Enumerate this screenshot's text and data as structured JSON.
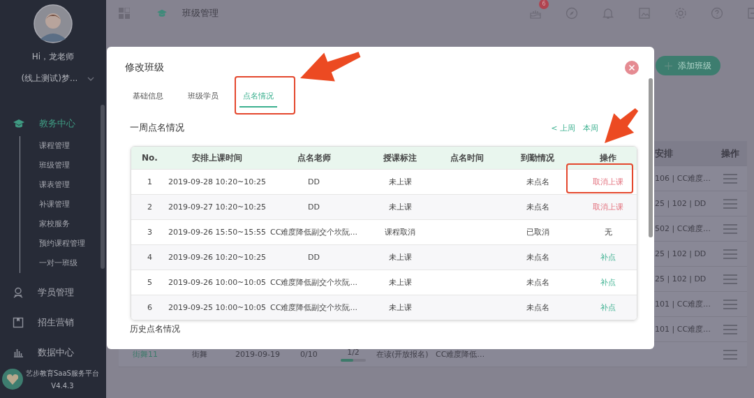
{
  "sidebar": {
    "greeting": "Hi，龙老师",
    "school": "(线上测试)梦...",
    "menu": [
      {
        "label": "教务中心",
        "selected": true,
        "children": [
          {
            "label": "课程管理"
          },
          {
            "label": "班级管理"
          },
          {
            "label": "课表管理"
          },
          {
            "label": "补课管理"
          },
          {
            "label": "家校服务"
          },
          {
            "label": "预约课程管理"
          },
          {
            "label": "一对一班级"
          }
        ]
      },
      {
        "label": "学员管理",
        "selected": false
      },
      {
        "label": "招生营销",
        "selected": false
      },
      {
        "label": "数据中心",
        "selected": false
      }
    ],
    "brand": "艺步教育SaaS服务平台",
    "version": "V4.4.3"
  },
  "topbar": {
    "title": "班级管理",
    "badge": "6"
  },
  "background": {
    "add_button": "添加班级",
    "table": {
      "columns": [
        "安排",
        "操作"
      ],
      "rows": [
        {
          "schedule": "106 | CC难度…"
        },
        {
          "schedule": "25 | 102 | DD"
        },
        {
          "schedule": "502 | CC难度…"
        },
        {
          "schedule": "25 | 102 | DD"
        },
        {
          "schedule": "25 | 102 | DD"
        },
        {
          "schedule": "101 | CC难度…"
        },
        {
          "schedule": "101 | CC难度…"
        },
        {
          "cells": [
            "街舞11",
            "街舞",
            "2019-09-19",
            "0/10"
          ],
          "progress": "1/2",
          "level": 0.5,
          "status": "在读(开放报名)",
          "teacher": "CC难度降低…"
        }
      ]
    }
  },
  "dialog": {
    "title": "修改班级",
    "tabs": [
      {
        "label": "基础信息",
        "selected": false
      },
      {
        "label": "班级学员",
        "selected": false
      },
      {
        "label": "点名情况",
        "selected": true
      }
    ],
    "section": "一周点名情况",
    "week_links": [
      "< 上周",
      "本周"
    ],
    "table": {
      "columns": [
        "No.",
        "安排上课时间",
        "点名老师",
        "授课标注",
        "点名时间",
        "到勤情况",
        "操作"
      ],
      "rows": [
        {
          "no": "1",
          "time": "2019-09-28 10:20~10:25",
          "teacher": "DD",
          "mark": "未上课",
          "attendance": "未点名",
          "action": "取消上课",
          "kind": "cancel"
        },
        {
          "no": "2",
          "time": "2019-09-27 10:20~10:25",
          "teacher": "DD",
          "mark": "未上课",
          "attendance": "未点名",
          "action": "取消上课",
          "kind": "cancel"
        },
        {
          "no": "3",
          "time": "2019-09-26 15:50~15:55",
          "teacher": "CC难度降低副交个坎阮...",
          "mark": "课程取消",
          "attendance": "已取消",
          "action": "无",
          "kind": "none"
        },
        {
          "no": "4",
          "time": "2019-09-26 10:20~10:25",
          "teacher": "DD",
          "mark": "未上课",
          "attendance": "未点名",
          "action": "补点",
          "kind": "makeup"
        },
        {
          "no": "5",
          "time": "2019-09-26 10:00~10:05",
          "teacher": "CC难度降低副交个坎阮...",
          "mark": "未上课",
          "attendance": "未点名",
          "action": "补点",
          "kind": "makeup"
        },
        {
          "no": "6",
          "time": "2019-09-25 10:00~10:05",
          "teacher": "CC难度降低副交个坎阮...",
          "mark": "未上课",
          "attendance": "未点名",
          "action": "补点",
          "kind": "makeup"
        }
      ]
    },
    "history": "历史点名情况"
  }
}
